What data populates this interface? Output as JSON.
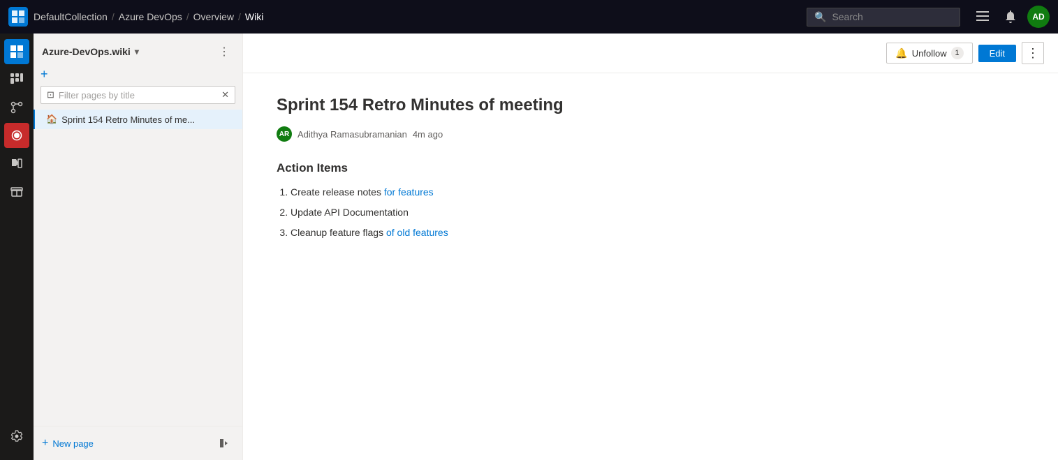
{
  "topbar": {
    "logo_text": "AD",
    "breadcrumbs": [
      {
        "label": "DefaultCollection",
        "sep": "/"
      },
      {
        "label": "Azure DevOps",
        "sep": "/"
      },
      {
        "label": "Overview",
        "sep": "/"
      },
      {
        "label": "Wiki",
        "sep": null
      }
    ],
    "search_placeholder": "Search",
    "user_initials": "AD"
  },
  "icon_sidebar": {
    "items": [
      {
        "name": "overview",
        "icon": "⊞"
      },
      {
        "name": "boards",
        "icon": "⬛"
      },
      {
        "name": "repos",
        "icon": "📁"
      },
      {
        "name": "pipelines",
        "icon": "🔴"
      },
      {
        "name": "testplans",
        "icon": "🧪"
      },
      {
        "name": "artifacts",
        "icon": "📦"
      }
    ],
    "settings_icon": "⚙",
    "active": "overview"
  },
  "page_sidebar": {
    "wiki_title": "Azure-DevOps.wiki",
    "filter_placeholder": "Filter pages by title",
    "pages": [
      {
        "title": "Sprint 154 Retro Minutes of me...",
        "is_home": true
      }
    ],
    "new_page_label": "New page"
  },
  "toolbar": {
    "unfollow_label": "Unfollow",
    "follower_count": "1",
    "edit_label": "Edit"
  },
  "content": {
    "page_title": "Sprint 154 Retro Minutes of meeting",
    "author_initials": "AR",
    "author_name": "Adithya Ramasubramanian",
    "time_ago": "4m ago",
    "section_title": "Action Items",
    "action_items": [
      {
        "text": "Create release notes ",
        "link_text": "for features",
        "suffix": ""
      },
      {
        "text": "Update API Documentation",
        "link_text": "",
        "suffix": ""
      },
      {
        "text": "Cleanup feature flags ",
        "link_text": "of old features",
        "suffix": ""
      }
    ]
  }
}
